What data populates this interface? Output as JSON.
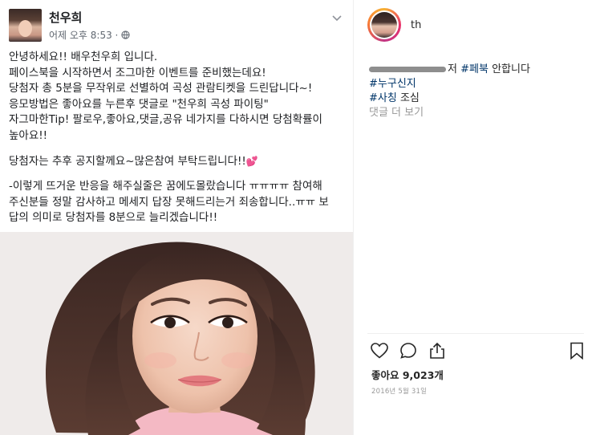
{
  "facebook_post": {
    "author_name": "천우희",
    "timestamp": "어제 오후 8:53 ·",
    "body_paragraphs": [
      "안녕하세요!! 배우천우희 입니다.\n페이스북을 시작하면서 조그마한 이벤트를 준비했는데요!\n당첨자 총 5분을 무작위로 선별하여 곡성 관람티켓을 드린답니다~!\n응모방법은 좋아요를 누른후 댓글로 \"천우희 곡성 파이팅\"\n자그마한Tip! 팔로우,좋아요,댓글,공유 네가지를 다하시면 당첨확률이\n높아요!!",
      "당첨자는 추후 공지할께요~많은참여 부탁드립니다!!",
      "-이렇게 뜨거운 반응을 해주실줄은 꿈에도몰랐습니다 ㅠㅠㅠㅠ 참여해\n주신분들 정말 감사하고 메세지 답장 못해드리는거 죄송합니다..ㅠㅠ 보\n답의 의미로 당첨자를 8분으로 늘리겠습니다!!"
    ],
    "emoji": "💕",
    "icons": {
      "privacy": "globe-icon",
      "menu": "chevron-down-icon"
    }
  },
  "instagram": {
    "username": "th",
    "comment_suffix": "저",
    "comment_hashtag_1": "#페북",
    "comment_tail": " 안합니다",
    "hashtag_2": "#누구신지",
    "hashtag_3": "#사칭",
    "hashtag_3_tail": " 조심",
    "view_comments": "댓글 더 보기",
    "likes": "좋아요 9,023개",
    "date": "2016년 5월 31일",
    "icons": {
      "like": "heart-outline-icon",
      "comment": "comment-bubble-icon",
      "share": "share-upload-icon",
      "save": "bookmark-icon"
    }
  }
}
